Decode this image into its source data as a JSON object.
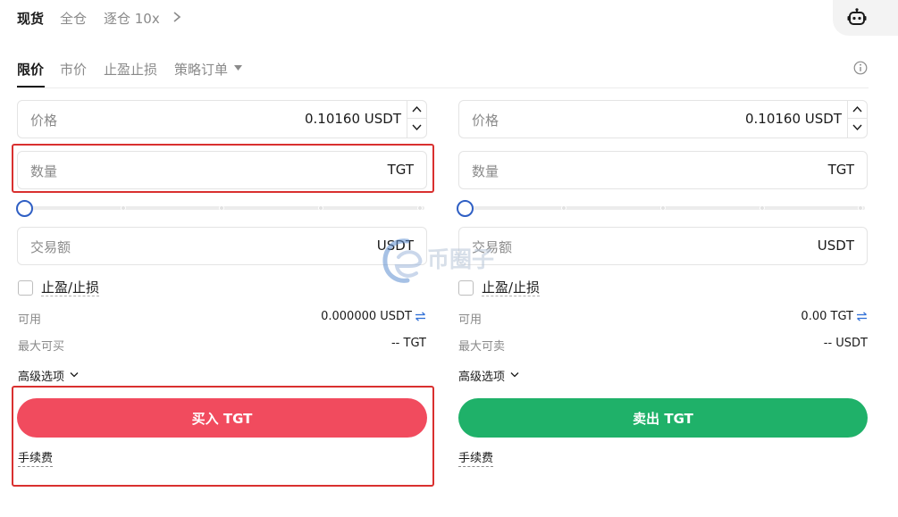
{
  "top_tabs": [
    "现货",
    "全仓",
    "逐仓 10x"
  ],
  "order_types": [
    "限价",
    "市价",
    "止盈止损",
    "策略订单"
  ],
  "buy_panel": {
    "price": {
      "label": "价格",
      "value": "0.10160 USDT"
    },
    "quantity": {
      "label": "数量",
      "unit": "TGT"
    },
    "amount": {
      "label": "交易额",
      "unit": "USDT"
    },
    "tpsl_label": "止盈/止损",
    "available_label": "可用",
    "available_value": "0.000000 USDT",
    "max_label": "最大可买",
    "max_value": "-- TGT",
    "advanced_label": "高级选项",
    "action_label": "买入 TGT",
    "fee_label": "手续费",
    "slider_percent": 0
  },
  "sell_panel": {
    "price": {
      "label": "价格",
      "value": "0.10160 USDT"
    },
    "quantity": {
      "label": "数量",
      "unit": "TGT"
    },
    "amount": {
      "label": "交易额",
      "unit": "USDT"
    },
    "tpsl_label": "止盈/止损",
    "available_label": "可用",
    "available_value": "0.00 TGT",
    "max_label": "最大可卖",
    "max_value": "-- USDT",
    "advanced_label": "高级选项",
    "action_label": "卖出 TGT",
    "fee_label": "手续费",
    "slider_percent": 0
  },
  "watermark_text": "币圈子",
  "icons": {
    "top_chevron": "chevron-right-icon",
    "bot": "robot-icon",
    "info": "info-icon",
    "swap": "swap-icon"
  },
  "colors": {
    "buy": "#f14b5e",
    "sell": "#1fb169",
    "slider_thumb": "#2f5fc4",
    "swap_icon": "#2f6fd6",
    "highlight": "#d9302f"
  }
}
